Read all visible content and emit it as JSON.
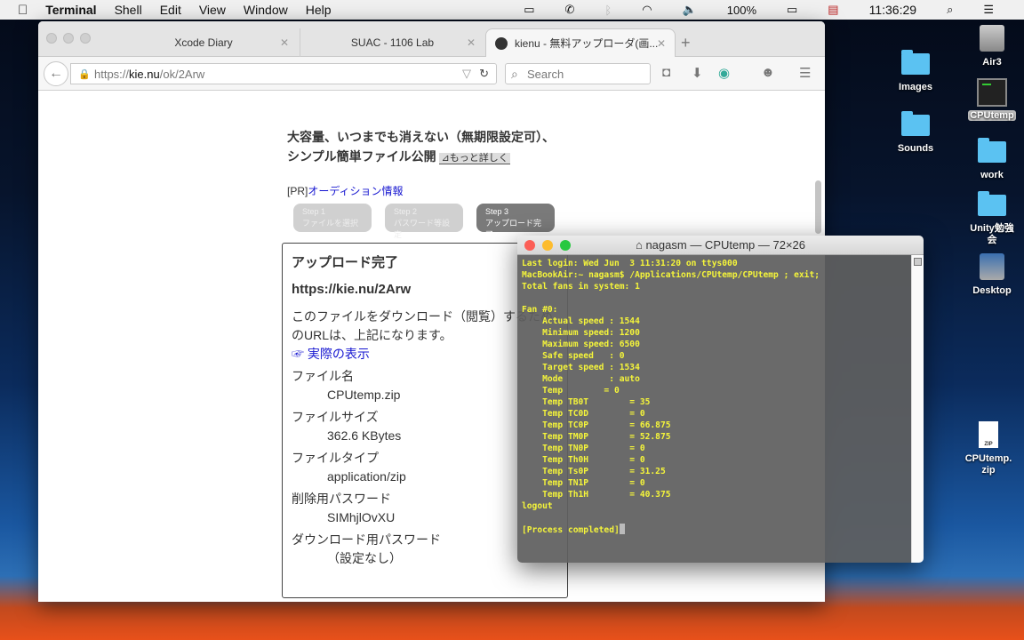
{
  "menubar": {
    "app": "Terminal",
    "items": [
      "Shell",
      "Edit",
      "View",
      "Window",
      "Help"
    ],
    "battery": "100%",
    "clock": "11:36:29"
  },
  "browser": {
    "tabs": [
      {
        "label": "Xcode Diary"
      },
      {
        "label": "SUAC - 1106 Lab"
      },
      {
        "label": "kienu - 無料アップローダ(画..."
      }
    ],
    "url_prefix": "https://",
    "url_host": "kie.nu",
    "url_path": "/ok/2Arw",
    "search_placeholder": "Search",
    "page": {
      "lead": "大容量、いつまでも消えない（無期限設定可）、シンプル簡単ファイル公開",
      "more": "⊿もっと詳しく",
      "pr_prefix": "[PR]",
      "pr_link": "オーディション情報",
      "steps": [
        {
          "n": "Step 1",
          "t": "ファイルを選択"
        },
        {
          "n": "Step 2",
          "t": "パスワード等設定"
        },
        {
          "n": "Step 3",
          "t": "アップロード完了"
        }
      ],
      "card": {
        "title": "アップロード完了",
        "link": "https://kie.nu/2Arw",
        "desc": "このファイルをダウンロード（閲覧）するためのURLは、上記になります。",
        "view_link": "☞ 実際の表示",
        "fields": [
          {
            "label": "ファイル名",
            "value": "CPUtemp.zip"
          },
          {
            "label": "ファイルサイズ",
            "value": "362.6 KBytes"
          },
          {
            "label": "ファイルタイプ",
            "value": "application/zip"
          },
          {
            "label": "削除用パスワード",
            "value": "SIMhjlOvXU"
          },
          {
            "label": "ダウンロード用パスワード",
            "value": "（設定なし）"
          }
        ]
      }
    }
  },
  "terminal": {
    "title": "nagasm — CPUtemp — 72×26",
    "lines": [
      "Last login: Wed Jun  3 11:31:20 on ttys000",
      "MacBookAir:~ nagasm$ /Applications/CPUtemp/CPUtemp ; exit;",
      "Total fans in system: 1",
      "",
      "Fan #0:",
      "    Actual speed : 1544",
      "    Minimum speed: 1200",
      "    Maximum speed: 6500",
      "    Safe speed   : 0",
      "    Target speed : 1534",
      "    Mode         : auto",
      "    Temp        = 0",
      "    Temp TB0T        = 35",
      "    Temp TC0D        = 0",
      "    Temp TC0P        = 66.875",
      "    Temp TM0P        = 52.875",
      "    Temp TN0P        = 0",
      "    Temp Th0H        = 0",
      "    Temp Ts0P        = 31.25",
      "    Temp TN1P        = 0",
      "    Temp Th1H        = 40.375",
      "logout",
      ""
    ],
    "last": "[Process completed]"
  },
  "desktop": {
    "icons": [
      "Air3",
      "Images",
      "CPUtemp",
      "Sounds",
      "work",
      "Unity勉強会",
      "Desktop",
      "CPUtemp.zip"
    ]
  }
}
